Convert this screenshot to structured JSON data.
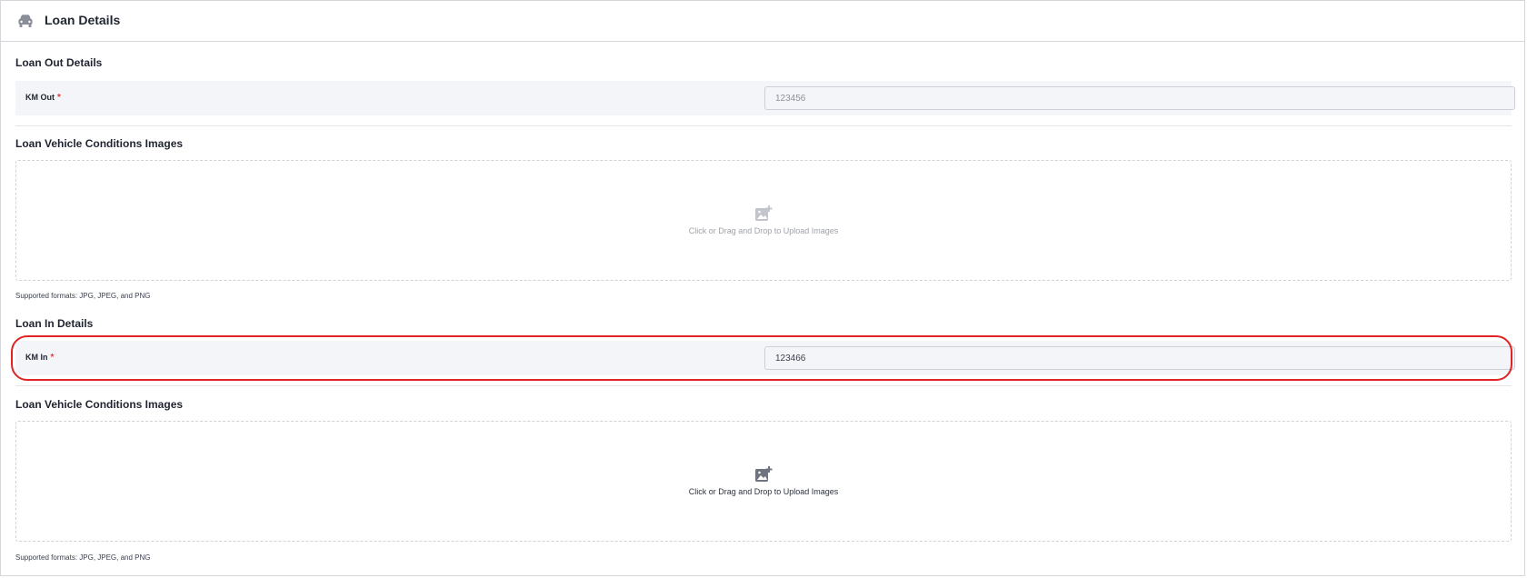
{
  "header": {
    "title": "Loan Details",
    "icon": "car-icon"
  },
  "loan_out": {
    "section_title": "Loan Out Details",
    "km_label": "KM Out",
    "required_mark": "*",
    "km_value": "123456"
  },
  "out_images": {
    "section_title": "Loan Vehicle Conditions Images",
    "upload_icon": "add-photo-icon",
    "upload_text": "Click or Drag and Drop to Upload Images",
    "formats": "Supported formats: JPG, JPEG, and PNG"
  },
  "loan_in": {
    "section_title": "Loan In Details",
    "km_label": "KM In",
    "required_mark": "*",
    "km_value": "123466"
  },
  "in_images": {
    "section_title": "Loan Vehicle Conditions Images",
    "upload_icon": "add-photo-icon",
    "upload_text": "Click or Drag and Drop to Upload Images",
    "formats": "Supported formats: JPG, JPEG, and PNG"
  },
  "colors": {
    "highlight": "#e02424",
    "required": "#e03a3a",
    "row_background": "#f4f5f8"
  }
}
